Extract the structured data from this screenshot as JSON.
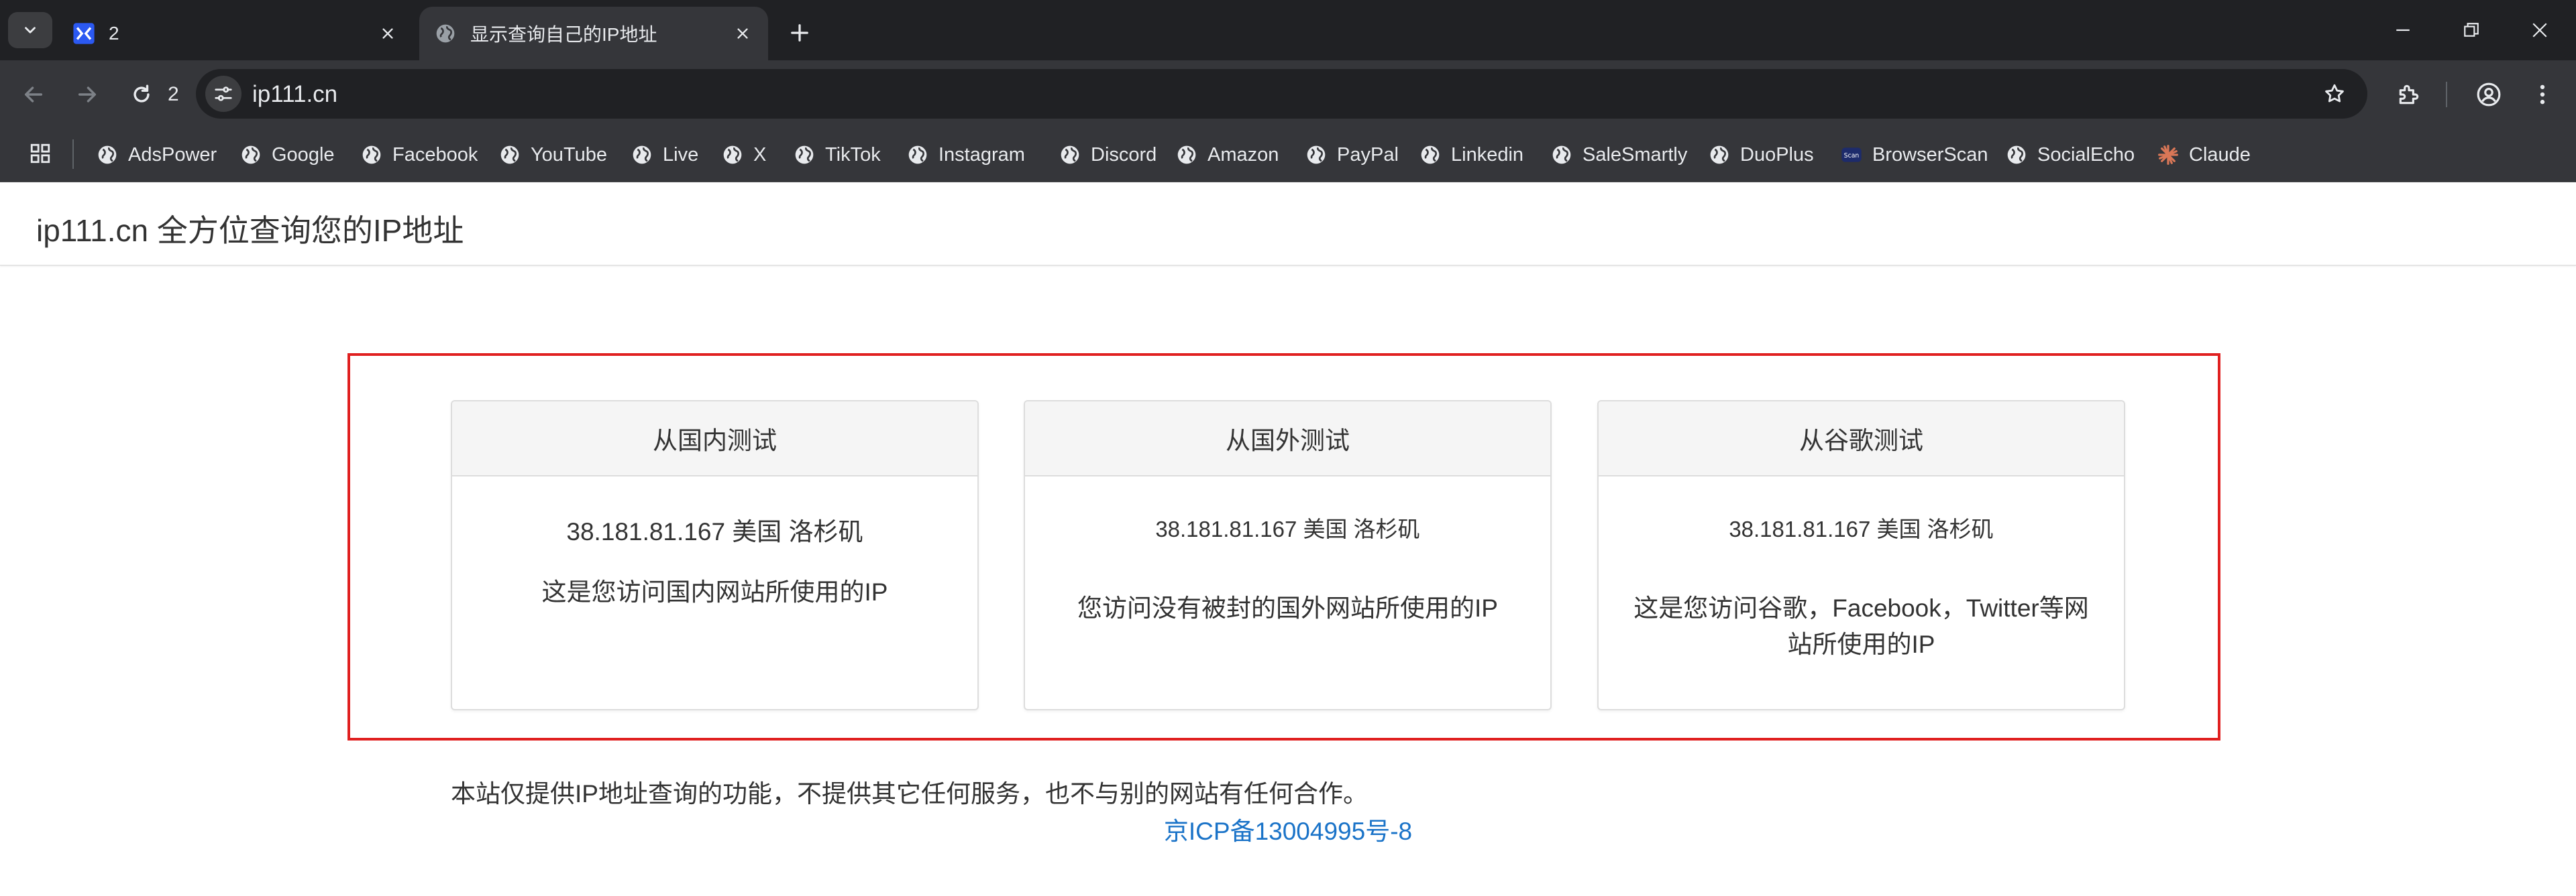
{
  "browser": {
    "tabs": [
      {
        "title": "2",
        "favicon": "app-logo-icon",
        "active": false
      },
      {
        "title": "显示查询自己的IP地址",
        "favicon": "globe-icon",
        "active": true
      }
    ],
    "reload_count": "2",
    "url": "ip111.cn",
    "bookmarks": [
      {
        "label": "AdsPower",
        "icon": "globe-icon"
      },
      {
        "label": "Google",
        "icon": "globe-icon"
      },
      {
        "label": "Facebook",
        "icon": "globe-icon"
      },
      {
        "label": "YouTube",
        "icon": "globe-icon"
      },
      {
        "label": "Live",
        "icon": "globe-icon"
      },
      {
        "label": "X",
        "icon": "globe-icon"
      },
      {
        "label": "TikTok",
        "icon": "globe-icon"
      },
      {
        "label": "Instagram",
        "icon": "globe-icon"
      },
      {
        "label": "Discord",
        "icon": "globe-icon"
      },
      {
        "label": "Amazon",
        "icon": "globe-icon"
      },
      {
        "label": "PayPal",
        "icon": "globe-icon"
      },
      {
        "label": "Linkedin",
        "icon": "globe-icon"
      },
      {
        "label": "SaleSmartly",
        "icon": "globe-icon"
      },
      {
        "label": "DuoPlus",
        "icon": "globe-icon"
      },
      {
        "label": "BrowserScan",
        "icon": "browserscan-logo-icon"
      },
      {
        "label": "SocialEcho",
        "icon": "globe-icon"
      },
      {
        "label": "Claude",
        "icon": "claude-logo-icon"
      }
    ]
  },
  "page": {
    "brand": "ip111.cn 全方位查询您的IP地址",
    "panels": [
      {
        "heading": "从国内测试",
        "ip": "38.181.81.167 美国 洛杉矶",
        "description": "这是您访问国内网站所使用的IP"
      },
      {
        "heading": "从国外测试",
        "ip": "38.181.81.167 美国 洛杉矶",
        "description": "您访问没有被封的国外网站所使用的IP"
      },
      {
        "heading": "从谷歌测试",
        "ip": "38.181.81.167 美国 洛杉矶",
        "description": "这是您访问谷歌，Facebook，Twitter等网站所使用的IP"
      }
    ],
    "disclaimer": "本站仅提供IP地址查询的功能，不提供其它任何服务，也不与别的网站有任何合作。",
    "icp": "京ICP备13004995号-8"
  },
  "colors": {
    "highlight_border": "#e02020",
    "link": "#1a73c8",
    "chrome_dark": "#202124",
    "chrome_toolbar": "#35363a"
  }
}
